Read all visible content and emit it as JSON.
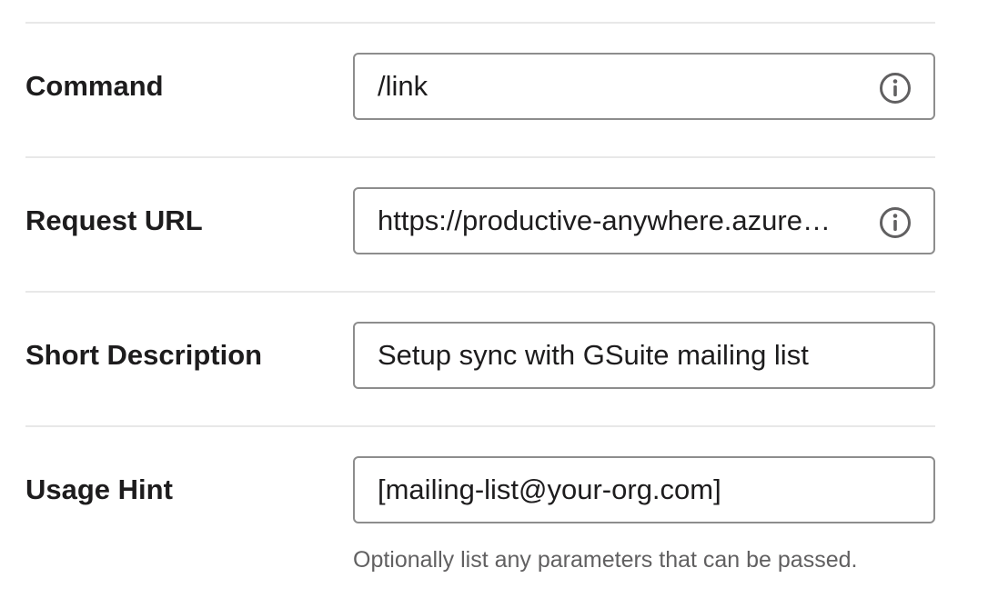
{
  "rows": [
    {
      "label": "Command",
      "value": "/link",
      "icon": "info-icon"
    },
    {
      "label": "Request URL",
      "value": "https://productive-anywhere.azurewebsites.net/api/slack/command",
      "icon": "info-icon"
    },
    {
      "label": "Short Description",
      "value": "Setup sync with GSuite mailing list"
    },
    {
      "label": "Usage Hint",
      "value": "[mailing-list@your-org.com]",
      "hint": "Optionally list any parameters that can be passed."
    }
  ],
  "colors": {
    "border": "#8d8d8d",
    "divider": "#e8e8e8",
    "text": "#1d1c1d",
    "hint": "#616061"
  }
}
